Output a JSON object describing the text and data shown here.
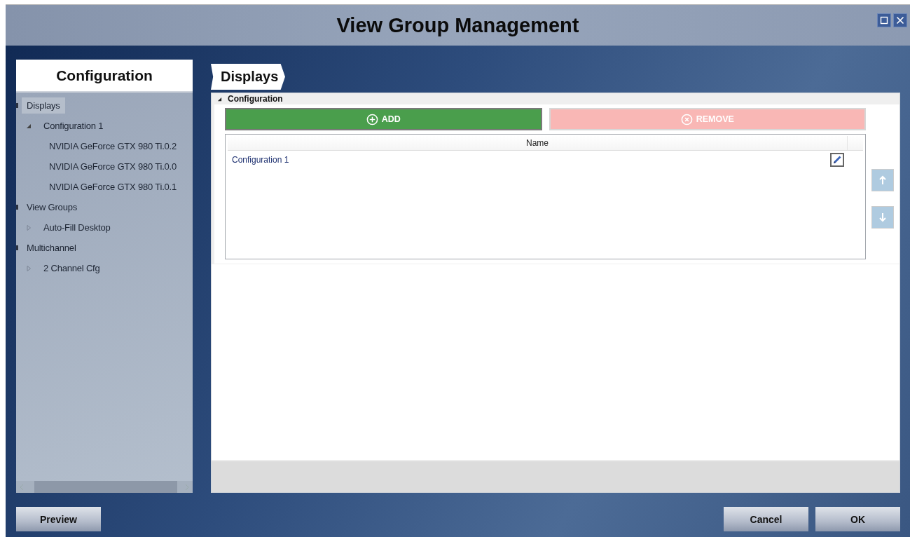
{
  "window": {
    "title": "View Group Management"
  },
  "sidebar": {
    "title": "Configuration",
    "tree": [
      {
        "label": "Displays",
        "selected": true,
        "children": [
          {
            "label": "Configuration 1",
            "selected": false,
            "expanded": true,
            "children": [
              {
                "label": "NVIDIA GeForce GTX 980 Ti.0.2",
                "selected": false
              },
              {
                "label": "NVIDIA GeForce GTX 980 Ti.0.0",
                "selected": false
              },
              {
                "label": "NVIDIA GeForce GTX 980 Ti.0.1",
                "selected": false
              }
            ]
          }
        ]
      },
      {
        "label": "View Groups",
        "selected": false,
        "children": [
          {
            "label": "Auto-Fill Desktop",
            "selected": false,
            "expanded": false
          }
        ]
      },
      {
        "label": "Multichannel",
        "selected": false,
        "children": [
          {
            "label": "2 Channel Cfg",
            "selected": false,
            "expanded": false
          }
        ]
      }
    ]
  },
  "tab": {
    "label": "Displays"
  },
  "section": {
    "title": "Configuration",
    "expanded": true,
    "buttons": [
      {
        "kind": "add",
        "label": "ADD",
        "disabled": false
      },
      {
        "kind": "remove",
        "label": "REMOVE",
        "disabled": true
      }
    ],
    "table": {
      "columns": [
        "Name"
      ],
      "rows": [
        {
          "name": "Configuration 1"
        }
      ]
    },
    "move_buttons": [
      {
        "kind": "up",
        "disabled": true
      },
      {
        "kind": "down",
        "disabled": true
      }
    ]
  },
  "footer": {
    "left_buttons": [
      "Preview"
    ],
    "right_buttons": [
      "Cancel",
      "OK"
    ]
  }
}
